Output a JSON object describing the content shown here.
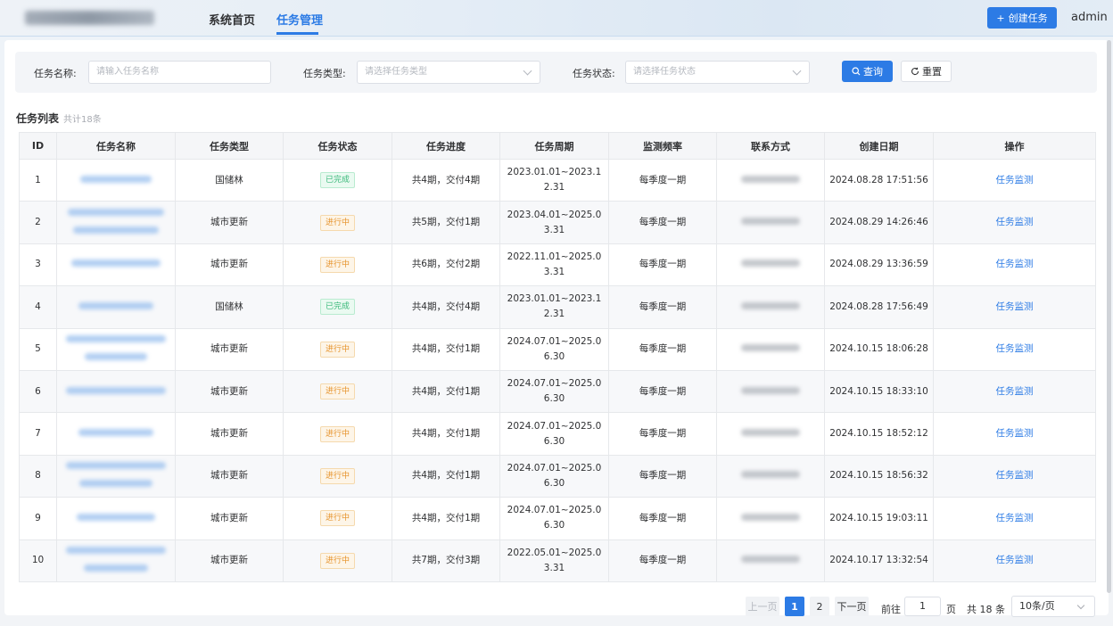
{
  "header": {
    "nav": [
      "系统首页",
      "任务管理"
    ],
    "active_nav": "任务管理",
    "create_button": "创建任务",
    "user": "admin"
  },
  "filters": {
    "name_label": "任务名称:",
    "name_placeholder": "请输入任务名称",
    "type_label": "任务类型:",
    "type_placeholder": "请选择任务类型",
    "status_label": "任务状态:",
    "status_placeholder": "请选择任务状态",
    "query_button": "查询",
    "reset_button": "重置"
  },
  "list": {
    "title": "任务列表",
    "count_text": "共计18条"
  },
  "table": {
    "columns": [
      "ID",
      "任务名称",
      "任务类型",
      "任务状态",
      "任务进度",
      "任务周期",
      "监测频率",
      "联系方式",
      "创建日期",
      "操作"
    ],
    "rows": [
      {
        "id": "1",
        "type": "国储林",
        "status": "已完成",
        "status_kind": "done",
        "progress": "共4期，交付4期",
        "period": "2023.01.01~2023.12.31",
        "freq": "每季度一期",
        "created": "2024.08.28 17:51:56",
        "op": "任务监测"
      },
      {
        "id": "2",
        "type": "城市更新",
        "status": "进行中",
        "status_kind": "doing",
        "progress": "共5期，交付1期",
        "period": "2023.04.01~2025.03.31",
        "freq": "每季度一期",
        "created": "2024.08.29 14:26:46",
        "op": "任务监测"
      },
      {
        "id": "3",
        "type": "城市更新",
        "status": "进行中",
        "status_kind": "doing",
        "progress": "共6期，交付2期",
        "period": "2022.11.01~2025.03.31",
        "freq": "每季度一期",
        "created": "2024.08.29 13:36:59",
        "op": "任务监测"
      },
      {
        "id": "4",
        "type": "国储林",
        "status": "已完成",
        "status_kind": "done",
        "progress": "共4期，交付4期",
        "period": "2023.01.01~2023.12.31",
        "freq": "每季度一期",
        "created": "2024.08.28 17:56:49",
        "op": "任务监测"
      },
      {
        "id": "5",
        "type": "城市更新",
        "status": "进行中",
        "status_kind": "doing",
        "progress": "共4期，交付1期",
        "period": "2024.07.01~2025.06.30",
        "freq": "每季度一期",
        "created": "2024.10.15 18:06:28",
        "op": "任务监测"
      },
      {
        "id": "6",
        "type": "城市更新",
        "status": "进行中",
        "status_kind": "doing",
        "progress": "共4期，交付1期",
        "period": "2024.07.01~2025.06.30",
        "freq": "每季度一期",
        "created": "2024.10.15 18:33:10",
        "op": "任务监测"
      },
      {
        "id": "7",
        "type": "城市更新",
        "status": "进行中",
        "status_kind": "doing",
        "progress": "共4期，交付1期",
        "period": "2024.07.01~2025.06.30",
        "freq": "每季度一期",
        "created": "2024.10.15 18:52:12",
        "op": "任务监测"
      },
      {
        "id": "8",
        "type": "城市更新",
        "status": "进行中",
        "status_kind": "doing",
        "progress": "共4期，交付1期",
        "period": "2024.07.01~2025.06.30",
        "freq": "每季度一期",
        "created": "2024.10.15 18:56:32",
        "op": "任务监测"
      },
      {
        "id": "9",
        "type": "城市更新",
        "status": "进行中",
        "status_kind": "doing",
        "progress": "共4期，交付1期",
        "period": "2024.07.01~2025.06.30",
        "freq": "每季度一期",
        "created": "2024.10.15 19:03:11",
        "op": "任务监测"
      },
      {
        "id": "10",
        "type": "城市更新",
        "status": "进行中",
        "status_kind": "doing",
        "progress": "共7期，交付3期",
        "period": "2022.05.01~2025.03.31",
        "freq": "每季度一期",
        "created": "2024.10.17 13:32:54",
        "op": "任务监测"
      }
    ]
  },
  "pagination": {
    "prev": "上一页",
    "pages": [
      "1",
      "2"
    ],
    "current": "1",
    "next": "下一页",
    "goto_label": "前往",
    "goto_value": "1",
    "page_unit": "页",
    "total": "共 18 条",
    "page_size": "10条/页"
  },
  "colors": {
    "primary": "#2c7be5",
    "done": "#3bb97a",
    "doing": "#e6932b"
  }
}
